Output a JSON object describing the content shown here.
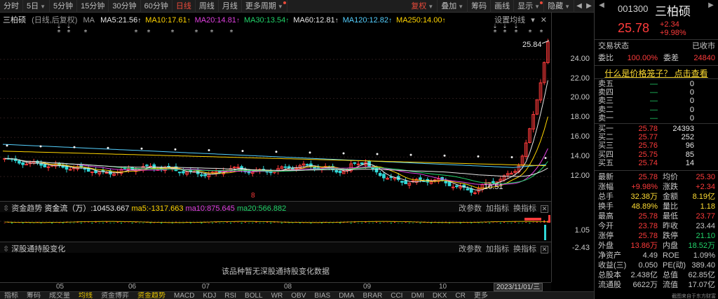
{
  "toolbar": {
    "items": [
      {
        "label": "分时"
      },
      {
        "label": "5日",
        "arrow": true
      },
      {
        "label": "5分钟"
      },
      {
        "label": "15分钟"
      },
      {
        "label": "30分钟"
      },
      {
        "label": "60分钟"
      },
      {
        "label": "日线",
        "active": true
      },
      {
        "label": "周线"
      },
      {
        "label": "月线"
      },
      {
        "label": "更多周期",
        "dot": true,
        "arrow": true
      }
    ],
    "right_items": [
      {
        "label": "复权",
        "arrow": true,
        "hl": true
      },
      {
        "label": "叠加",
        "arrow": true
      },
      {
        "label": "筹码"
      },
      {
        "label": "画线"
      },
      {
        "label": "显示",
        "arrow": true,
        "dot": true
      },
      {
        "label": "隐藏",
        "arrow": true
      }
    ],
    "nav_left": "◀",
    "nav_right": "▶"
  },
  "main": {
    "stock_name": "三柏硕",
    "period_note": "(日线,后复权)",
    "ma_label": "MA",
    "ma_items": [
      {
        "text": "MA5:21.56",
        "color": "#e6e6e6"
      },
      {
        "text": "MA10:17.61",
        "color": "#ffd400"
      },
      {
        "text": "MA20:14.81",
        "color": "#e040e0"
      },
      {
        "text": "MA30:13.54",
        "color": "#22d36a"
      },
      {
        "text": "MA60:12.81",
        "color": "#e6e6e6"
      },
      {
        "text": "MA120:12.82",
        "color": "#55d0ff"
      },
      {
        "text": "MA250:14.00",
        "color": "#ffd400"
      }
    ],
    "right_ctrl_label": "设置均线",
    "high_label": "25.84",
    "low_label": "10.51",
    "marker_char": "8"
  },
  "price_axis": {
    "ticks": [
      "24.00",
      "22.00",
      "20.00",
      "18.00",
      "16.00",
      "14.00",
      "12.00"
    ]
  },
  "flow": {
    "title": "资金趋势",
    "name": "资金流（万）",
    "value": ":10453.667",
    "ma5": "ma5:-1317.663",
    "ma10": "ma10:875.645",
    "ma20": "ma20:566.882",
    "ctrls": [
      "改参数",
      "加指标",
      "换指标"
    ],
    "axis_top": "1.05",
    "axis_bottom": "-2.43"
  },
  "hk": {
    "title": "深股通持股变化",
    "ctrls": [
      "改参数",
      "加指标",
      "换指标"
    ],
    "message": "该品种暂无深股通持股变化数据"
  },
  "time_axis": {
    "labels": [
      "05",
      "06",
      "07",
      "08",
      "09",
      "10"
    ],
    "current_date": "2023/11/01/三"
  },
  "bottom_tabs": [
    "指标",
    "筹码",
    "成交量",
    "均线",
    "资金博弈",
    "资金趋势",
    "MACD",
    "KDJ",
    "RSI",
    "BOLL",
    "WR",
    "OBV",
    "BIAS",
    "DMA",
    "BRAR",
    "CCI",
    "DMI",
    "DKX",
    "CR",
    "更多"
  ],
  "quote": {
    "code": "001300",
    "name": "三柏硕",
    "price": "25.78",
    "change": "+2.34",
    "change_pct": "+9.98%",
    "status_label": "交易状态",
    "status_value": "已收市",
    "ratio_label": "委比",
    "ratio_value": "100.00%",
    "diff_label": "委差",
    "diff_value": "24840",
    "cage_link": "什么是价格笼子？ 点击查看",
    "asks": [
      {
        "label": "卖五",
        "price": "—",
        "vol": "0"
      },
      {
        "label": "卖四",
        "price": "—",
        "vol": "0"
      },
      {
        "label": "卖三",
        "price": "—",
        "vol": "0"
      },
      {
        "label": "卖二",
        "price": "—",
        "vol": "0"
      },
      {
        "label": "卖一",
        "price": "—",
        "vol": "0"
      }
    ],
    "bids": [
      {
        "label": "买一",
        "price": "25.78",
        "vol": "24393"
      },
      {
        "label": "买二",
        "price": "25.77",
        "vol": "252"
      },
      {
        "label": "买三",
        "price": "25.76",
        "vol": "96"
      },
      {
        "label": "买四",
        "price": "25.75",
        "vol": "85"
      },
      {
        "label": "买五",
        "price": "25.74",
        "vol": "14"
      }
    ],
    "stats": [
      {
        "l1": "最新",
        "v1": "25.78",
        "c1": "red",
        "l2": "均价",
        "v2": "25.30",
        "c2": "red"
      },
      {
        "l1": "涨幅",
        "v1": "+9.98%",
        "c1": "red",
        "l2": "涨跌",
        "v2": "+2.34",
        "c2": "red"
      },
      {
        "l1": "总手",
        "v1": "32.38万",
        "c1": "yellow",
        "l2": "金额",
        "v2": "8.19亿",
        "c2": "yellow"
      },
      {
        "l1": "换手",
        "v1": "48.89%",
        "c1": "yellow",
        "l2": "量比",
        "v2": "1.18",
        "c2": "yellow"
      },
      {
        "l1": "最高",
        "v1": "25.78",
        "c1": "red",
        "l2": "最低",
        "v2": "23.77",
        "c2": "red"
      },
      {
        "l1": "今开",
        "v1": "23.78",
        "c1": "red",
        "l2": "昨收",
        "v2": "23.44",
        "c2": ""
      },
      {
        "l1": "涨停",
        "v1": "25.78",
        "c1": "red",
        "l2": "跌停",
        "v2": "21.10",
        "c2": "green"
      },
      {
        "l1": "外盘",
        "v1": "13.86万",
        "c1": "red",
        "l2": "内盘",
        "v2": "18.52万",
        "c2": "green"
      },
      {
        "l1": "净资产",
        "v1": "4.49",
        "c1": "",
        "l2": "ROE",
        "v2": "1.09%",
        "c2": ""
      },
      {
        "l1": "收益(三)",
        "v1": "0.050",
        "c1": "",
        "l2": "PE(动)",
        "v2": "389.40",
        "c2": ""
      },
      {
        "l1": "总股本",
        "v1": "2.438亿",
        "c1": "",
        "l2": "总值",
        "v2": "62.85亿",
        "c2": ""
      },
      {
        "l1": "流通股",
        "v1": "6622万",
        "c1": "",
        "l2": "流值",
        "v2": "17.07亿",
        "c2": ""
      }
    ],
    "watermark": "截图来自于东方财富"
  }
}
